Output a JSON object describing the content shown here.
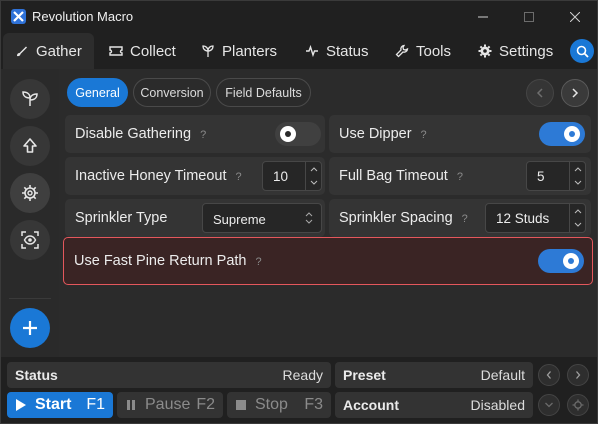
{
  "window": {
    "title": "Revolution Macro",
    "minimize_icon": "minimize-icon",
    "maximize_icon": "maximize-icon",
    "close_icon": "close-icon"
  },
  "tabs": [
    {
      "label": "Gather",
      "icon": "brush-icon",
      "active": true
    },
    {
      "label": "Collect",
      "icon": "ticket-icon",
      "active": false
    },
    {
      "label": "Planters",
      "icon": "planter-icon",
      "active": false
    },
    {
      "label": "Status",
      "icon": "pulse-icon",
      "active": false
    },
    {
      "label": "Tools",
      "icon": "wrench-icon",
      "active": false
    },
    {
      "label": "Settings",
      "icon": "gear-icon",
      "active": false
    }
  ],
  "sidebar": {
    "items": [
      {
        "icon": "sprout-icon"
      },
      {
        "icon": "arrow-up-icon"
      },
      {
        "icon": "gear-icon",
        "active": true
      },
      {
        "icon": "scan-eye-icon"
      }
    ],
    "add_label": "+"
  },
  "subtabs": [
    {
      "label": "General",
      "active": true
    },
    {
      "label": "Conversion",
      "active": false
    },
    {
      "label": "Field Defaults",
      "active": false
    }
  ],
  "settings": {
    "disable_gathering": {
      "label": "Disable Gathering",
      "help": "?",
      "enabled": false
    },
    "use_dipper": {
      "label": "Use Dipper",
      "help": "?",
      "enabled": true
    },
    "inactive_honey_timeout": {
      "label": "Inactive Honey Timeout",
      "help": "?",
      "value": "10"
    },
    "full_bag_timeout": {
      "label": "Full Bag Timeout",
      "help": "?",
      "value": "5"
    },
    "sprinkler_type": {
      "label": "Sprinkler Type",
      "value": "Supreme"
    },
    "sprinkler_spacing": {
      "label": "Sprinkler Spacing",
      "help": "?",
      "value": "12 Studs"
    },
    "use_fast_pine_return_path": {
      "label": "Use Fast Pine Return Path",
      "help": "?",
      "enabled": true
    }
  },
  "statusbar": {
    "status_key": "Status",
    "status_value": "Ready",
    "preset_key": "Preset",
    "preset_value": "Default",
    "account_key": "Account",
    "account_value": "Disabled",
    "start_label": "Start",
    "start_key": "F1",
    "pause_label": "Pause",
    "pause_key": "F2",
    "stop_label": "Stop",
    "stop_key": "F3"
  },
  "colors": {
    "accent": "#1a78d6",
    "toggle_on": "#2d7ad6",
    "highlight_border": "#e4575c"
  }
}
